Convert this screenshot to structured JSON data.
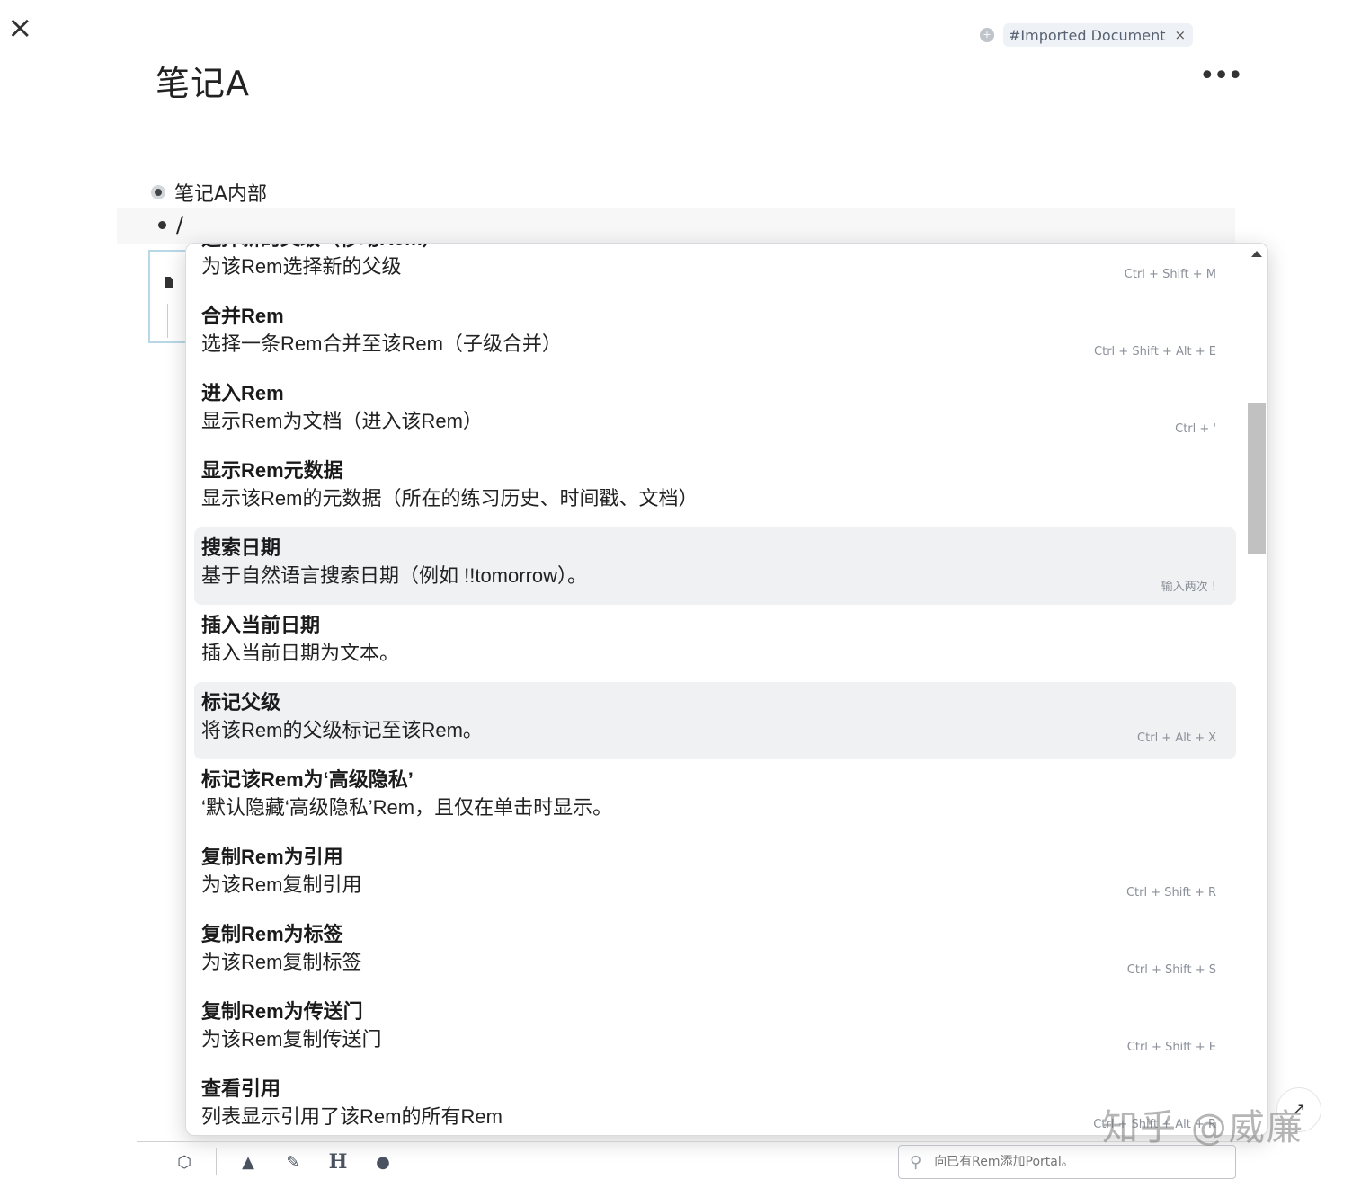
{
  "header": {
    "close_icon": "×",
    "tag_add_icon": "+",
    "tag_label": "#Imported Document",
    "tag_remove_icon": "×",
    "title": "笔记A",
    "more_icon": "•••"
  },
  "rems": {
    "first": "笔记A内部",
    "editing_text": "/"
  },
  "menu": {
    "items": [
      {
        "title": "选择新的父级（移动Rem）",
        "desc": "为该Rem选择新的父级",
        "shortcut": "Ctrl + Shift + M",
        "highlighted": false
      },
      {
        "title": "合并Rem",
        "desc": "选择一条Rem合并至该Rem（子级合并）",
        "shortcut": "Ctrl + Shift + Alt + E",
        "highlighted": false
      },
      {
        "title": "进入Rem",
        "desc": "显示Rem为文档（进入该Rem）",
        "shortcut": "Ctrl + '",
        "highlighted": false
      },
      {
        "title": "显示Rem元数据",
        "desc": "显示该Rem的元数据（所在的练习历史、时间戳、文档）",
        "shortcut": "",
        "highlighted": false
      },
      {
        "title": "搜索日期",
        "desc": "基于自然语言搜索日期（例如 !!tomorrow）。",
        "shortcut": "输入两次 !",
        "highlighted": true
      },
      {
        "title": "插入当前日期",
        "desc": "插入当前日期为文本。",
        "shortcut": "",
        "highlighted": false
      },
      {
        "title": "标记父级",
        "desc": "将该Rem的父级标记至该Rem。",
        "shortcut": "Ctrl + Alt + X",
        "highlighted": true
      },
      {
        "title": "标记该Rem为‘高级隐私’",
        "desc": "‘默认隐藏‘高级隐私’Rem，且仅在单击时显示。",
        "shortcut": "",
        "highlighted": false
      },
      {
        "title": "复制Rem为引用",
        "desc": "为该Rem复制引用",
        "shortcut": "Ctrl + Shift + R",
        "highlighted": false
      },
      {
        "title": "复制Rem为标签",
        "desc": "为该Rem复制标签",
        "shortcut": "Ctrl + Shift + S",
        "highlighted": false
      },
      {
        "title": "复制Rem为传送门",
        "desc": "为该Rem复制传送门",
        "shortcut": "Ctrl + Shift + E",
        "highlighted": false
      },
      {
        "title": "查看引用",
        "desc": "列表显示引用了该Rem的所有Rem",
        "shortcut": "Ctrl + Shift + Alt + R",
        "highlighted": false
      }
    ]
  },
  "toolbar": {
    "icons": [
      "cube-icon",
      "warning-icon",
      "brush-icon",
      "heading-icon",
      "circle-icon"
    ],
    "glyphs": [
      "⬡",
      "▲",
      "✎",
      "H",
      "●"
    ]
  },
  "portal_search": {
    "placeholder": "向已有Rem添加Portal。"
  },
  "watermark": "知乎 @威廉",
  "corner_glyph": "↗"
}
